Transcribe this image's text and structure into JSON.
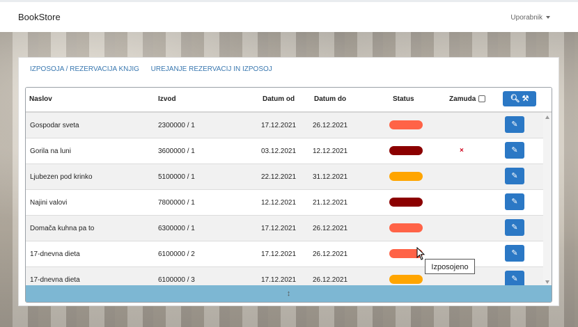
{
  "navbar": {
    "brand": "BookStore",
    "user_menu": "Uporabnik"
  },
  "tabs": [
    "IZPOSOJA / REZERVACIJA KNJIG",
    "UREJANJE REZERVACIJ IN IZPOSOJ"
  ],
  "table": {
    "headers": {
      "title": "Naslov",
      "source": "Izvod",
      "date_from": "Datum od",
      "date_to": "Datum do",
      "status": "Status",
      "delay": "Zamuda"
    },
    "search_icon": "search-icon",
    "rows": [
      {
        "title": "Gospodar sveta",
        "copy": "2300000 / 1",
        "from": "17.12.2021",
        "to": "26.12.2021",
        "status_color": "#ff6347",
        "delay": ""
      },
      {
        "title": "Gorila na luni",
        "copy": "3600000 / 1",
        "from": "03.12.2021",
        "to": "12.12.2021",
        "status_color": "#8b0000",
        "delay": "×"
      },
      {
        "title": "Ljubezen pod krinko",
        "copy": "5100000 / 1",
        "from": "22.12.2021",
        "to": "31.12.2021",
        "status_color": "#ffa500",
        "delay": ""
      },
      {
        "title": "Najini valovi",
        "copy": "7800000 / 1",
        "from": "12.12.2021",
        "to": "21.12.2021",
        "status_color": "#8b0000",
        "delay": ""
      },
      {
        "title": "Domača kuhna pa to",
        "copy": "6300000 / 1",
        "from": "17.12.2021",
        "to": "26.12.2021",
        "status_color": "#ff6347",
        "delay": ""
      },
      {
        "title": "17-dnevna dieta",
        "copy": "6100000 / 2",
        "from": "17.12.2021",
        "to": "26.12.2021",
        "status_color": "#ff6347",
        "delay": ""
      },
      {
        "title": "17-dnevna dieta",
        "copy": "6100000 / 3",
        "from": "17.12.2021",
        "to": "26.12.2021",
        "status_color": "#ffa500",
        "delay": ""
      }
    ]
  },
  "resize_glyph": "↕",
  "tooltip": "Izposojeno"
}
